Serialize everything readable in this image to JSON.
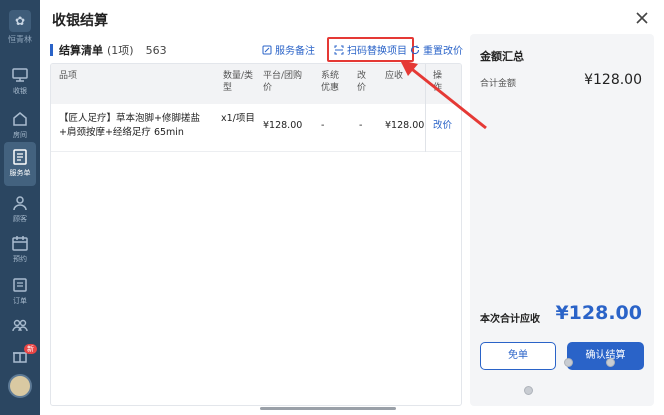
{
  "app": {
    "logo_text": "恒青林",
    "nav": [
      {
        "label": "收银",
        "icon": "cashier-icon"
      },
      {
        "label": "房间",
        "icon": "room-icon"
      },
      {
        "label": "服务单",
        "icon": "service-order-icon",
        "active": true
      },
      {
        "label": "顾客",
        "icon": "customer-icon"
      },
      {
        "label": "预约",
        "icon": "appointment-icon"
      },
      {
        "label": "订单",
        "icon": "order-icon"
      },
      {
        "label": "",
        "icon": "staff-icon"
      }
    ],
    "badge": "新"
  },
  "modal": {
    "title": "收银结算",
    "list_title": "结算清单",
    "list_count": "(1项)",
    "list_number": "563",
    "actions": {
      "service_note": "服务备注",
      "scan_replace": "扫码替换项目",
      "reset_price": "重置改价"
    },
    "table": {
      "headers": [
        "品项",
        "数量/类型",
        "平台/团购价",
        "系统优惠",
        "改价",
        "应收",
        "操作"
      ],
      "rows": [
        {
          "item": "【匠人足疗】草本泡脚+修脚搓盐+肩颈按摩+经络足疗 65min",
          "qty_type": "x1/项目",
          "platform_price": "¥128.00",
          "system_discount": "-",
          "price_change": "-",
          "receivable": "¥128.00",
          "action": "改价"
        }
      ]
    }
  },
  "summary": {
    "title": "金额汇总",
    "total_label": "合计金额",
    "total_value": "¥128.00",
    "due_label": "本次合计应收",
    "due_value": "¥128.00",
    "free_button": "免单",
    "confirm_button": "确认结算"
  },
  "colors": {
    "accent": "#2a63c8",
    "highlight_border": "#e53935",
    "rail": "#2b4661"
  }
}
